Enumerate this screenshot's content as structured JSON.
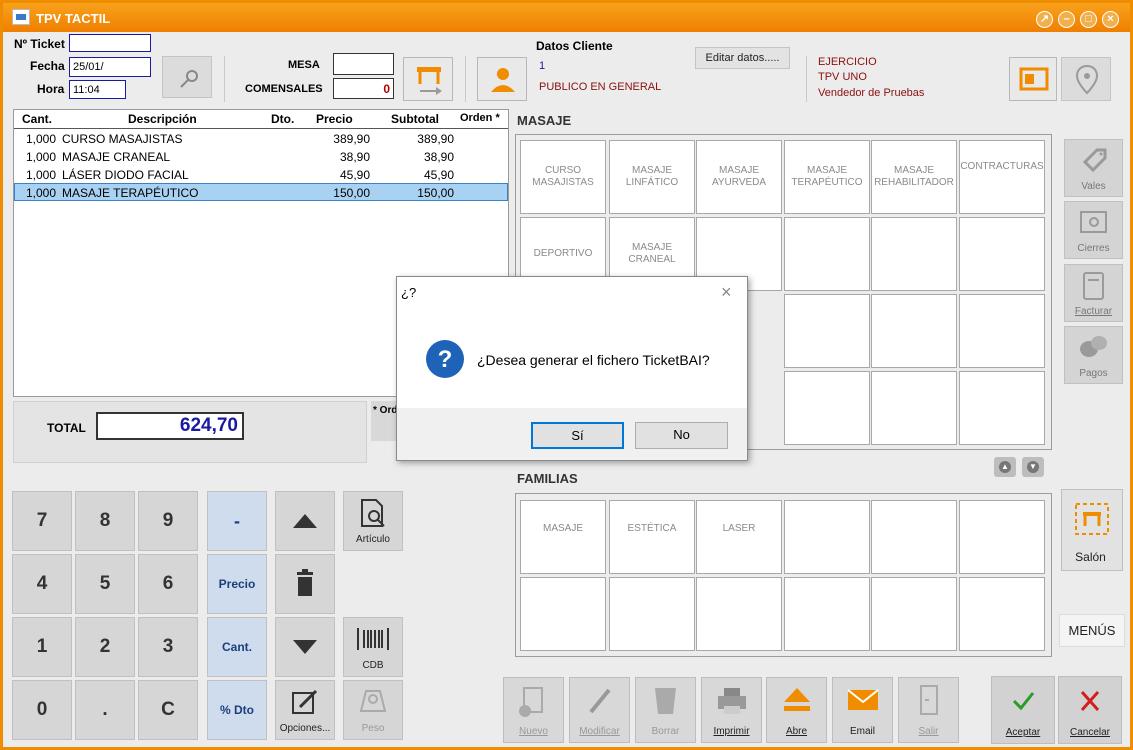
{
  "window": {
    "title": "TPV TACTIL"
  },
  "ticket_info": {
    "ticket_label": "Nº Ticket",
    "ticket_value": "",
    "fecha_label": "Fecha",
    "fecha_value": "25/01/",
    "hora_label": "Hora",
    "hora_value": "11:04"
  },
  "mesa": {
    "mesa_label": "MESA",
    "mesa_value": "",
    "comensales_label": "COMENSALES",
    "comensales_value": "0"
  },
  "cliente": {
    "header": "Datos Cliente",
    "id": "1",
    "name": "PUBLICO EN GENERAL",
    "edit_button": "Editar datos....."
  },
  "ejercicio": {
    "line1": "EJERCICIO",
    "line2": "TPV UNO",
    "line3": "Vendedor de Pruebas"
  },
  "table": {
    "columns": [
      "Cant.",
      "Descripción",
      "Dto.",
      "Precio",
      "Subtotal",
      "Orden *"
    ],
    "rows": [
      {
        "cant": "1,000",
        "desc": "CURSO MASAJISTAS",
        "dto": "",
        "precio": "389,90",
        "subtotal": "389,90"
      },
      {
        "cant": "1,000",
        "desc": "MASAJE CRANEAL",
        "dto": "",
        "precio": "38,90",
        "subtotal": "38,90"
      },
      {
        "cant": "1,000",
        "desc": "LÁSER DIODO FACIAL",
        "dto": "",
        "precio": "45,90",
        "subtotal": "45,90"
      },
      {
        "cant": "1,000",
        "desc": "MASAJE TERAPÉUTICO",
        "dto": "",
        "precio": "150,00",
        "subtotal": "150,00"
      }
    ]
  },
  "total": {
    "label": "TOTAL",
    "value": "624,70",
    "note": "* Ord"
  },
  "masaje": {
    "title": "MASAJE",
    "products": [
      "CURSO MASAJISTAS",
      "MASAJE LINFÁTICO",
      "MASAJE AYURVEDA",
      "MASAJE TERAPÉUTICO",
      "MASAJE REHABILITADOR",
      "CONTRACTURAS",
      "DEPORTIVO",
      "MASAJE CRANEAL"
    ]
  },
  "familias": {
    "title": "FAMILIAS",
    "items": [
      "MASAJE",
      "ESTÉTICA",
      "LASER"
    ]
  },
  "keypad": {
    "k7": "7",
    "k8": "8",
    "k9": "9",
    "minus": "-",
    "k4": "4",
    "k5": "5",
    "k6": "6",
    "precio": "Precio",
    "k1": "1",
    "k2": "2",
    "k3": "3",
    "cant": "Cant.",
    "k0": "0",
    "dot": ".",
    "clear": "C",
    "dto": "% Dto"
  },
  "tools": {
    "articulo": "Artículo",
    "cdb": "CDB",
    "opciones": "Opciones...",
    "peso": "Peso"
  },
  "side": {
    "vales": "Vales",
    "cierres": "Cierres",
    "facturar": "Facturar",
    "pagos": "Pagos",
    "salon": "Salón",
    "menus": "MENÚS"
  },
  "bottom": {
    "nuevo": "Nuevo",
    "modificar": "Modificar",
    "borrar": "Borrar",
    "imprimir": "Imprimir",
    "abre": "Abre",
    "email": "Email",
    "salir": "Salir",
    "aceptar": "Aceptar",
    "cancelar": "Cancelar"
  },
  "dialog": {
    "title": "¿?",
    "message": "¿Desea generar el fichero TicketBAI?",
    "yes": "Sí",
    "no": "No"
  },
  "colors": {
    "accent": "#f08c00",
    "selected_row": "#a9d2f2",
    "total_text": "#1a1aa0"
  }
}
